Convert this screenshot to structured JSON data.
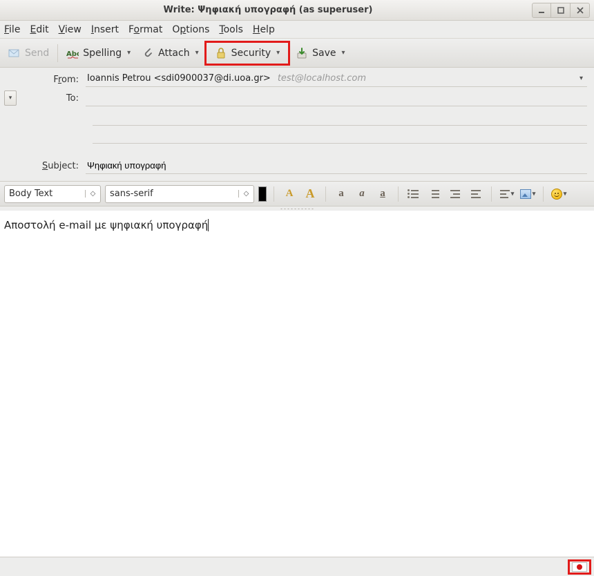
{
  "window": {
    "title": "Write: Ψηφιακή υπογραφή (as superuser)"
  },
  "menubar": {
    "file": "File",
    "edit": "Edit",
    "view": "View",
    "insert": "Insert",
    "format": "Format",
    "options": "Options",
    "tools": "Tools",
    "help": "Help"
  },
  "toolbar": {
    "send": "Send",
    "spelling": "Spelling",
    "attach": "Attach",
    "security": "Security",
    "save": "Save"
  },
  "headers": {
    "from_label": "From:",
    "from_value": "Ioannis Petrou <sdi0900037@di.uoa.gr>",
    "from_extra": "test@localhost.com",
    "to_label": "To:",
    "to_value": "",
    "subject_label": "Subject:",
    "subject_value": "Ψηφιακή υπογραφή"
  },
  "format_toolbar": {
    "paragraph_style": "Body Text",
    "font_family": "sans-serif"
  },
  "body": {
    "text": "Αποστολή e-mail με ψηφιακή υπογραφή"
  },
  "highlight": {
    "security_button": true,
    "language_indicator": true
  }
}
